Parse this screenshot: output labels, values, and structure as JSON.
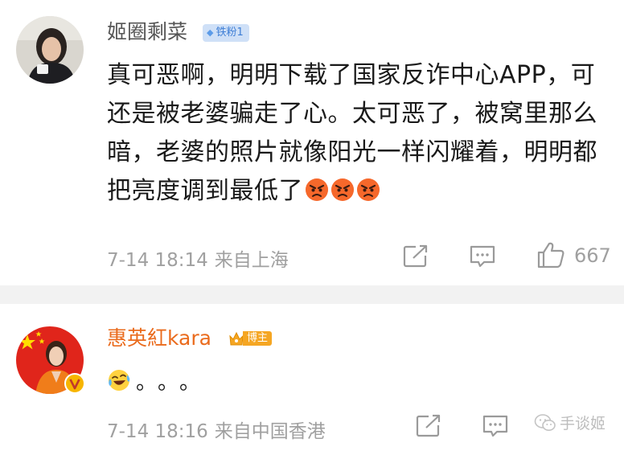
{
  "comments": [
    {
      "username": "姬圈剩菜",
      "badge": "铁粉1",
      "content": "真可恶啊，明明下载了国家反诈中心APP，可还是被老婆骗走了心。太可恶了，被窝里那么暗，老婆的照片就像阳光一样闪耀着，明明都把亮度调到最低了",
      "emoji": [
        "angry-face",
        "angry-face",
        "angry-face"
      ],
      "time": "7-14 18:14",
      "location": "来自上海",
      "likes": "667"
    },
    {
      "username": "惠英紅kara",
      "badge": "博主",
      "content": "。。。",
      "emoji": [
        "laughing-tears-face"
      ],
      "time": "7-14 18:16",
      "location": "来自中国香港"
    }
  ],
  "watermark": "手谈姬",
  "colors": {
    "username_highlight": "#ea6b1d",
    "fan_badge": "#cfe0f7",
    "blogger_badge": "#f5a623",
    "meta_gray": "#a0a0a0",
    "divider": "#f2f2f2"
  },
  "icons": {
    "share": "share-icon",
    "reply": "comment-icon",
    "like": "thumbs-up-icon"
  }
}
